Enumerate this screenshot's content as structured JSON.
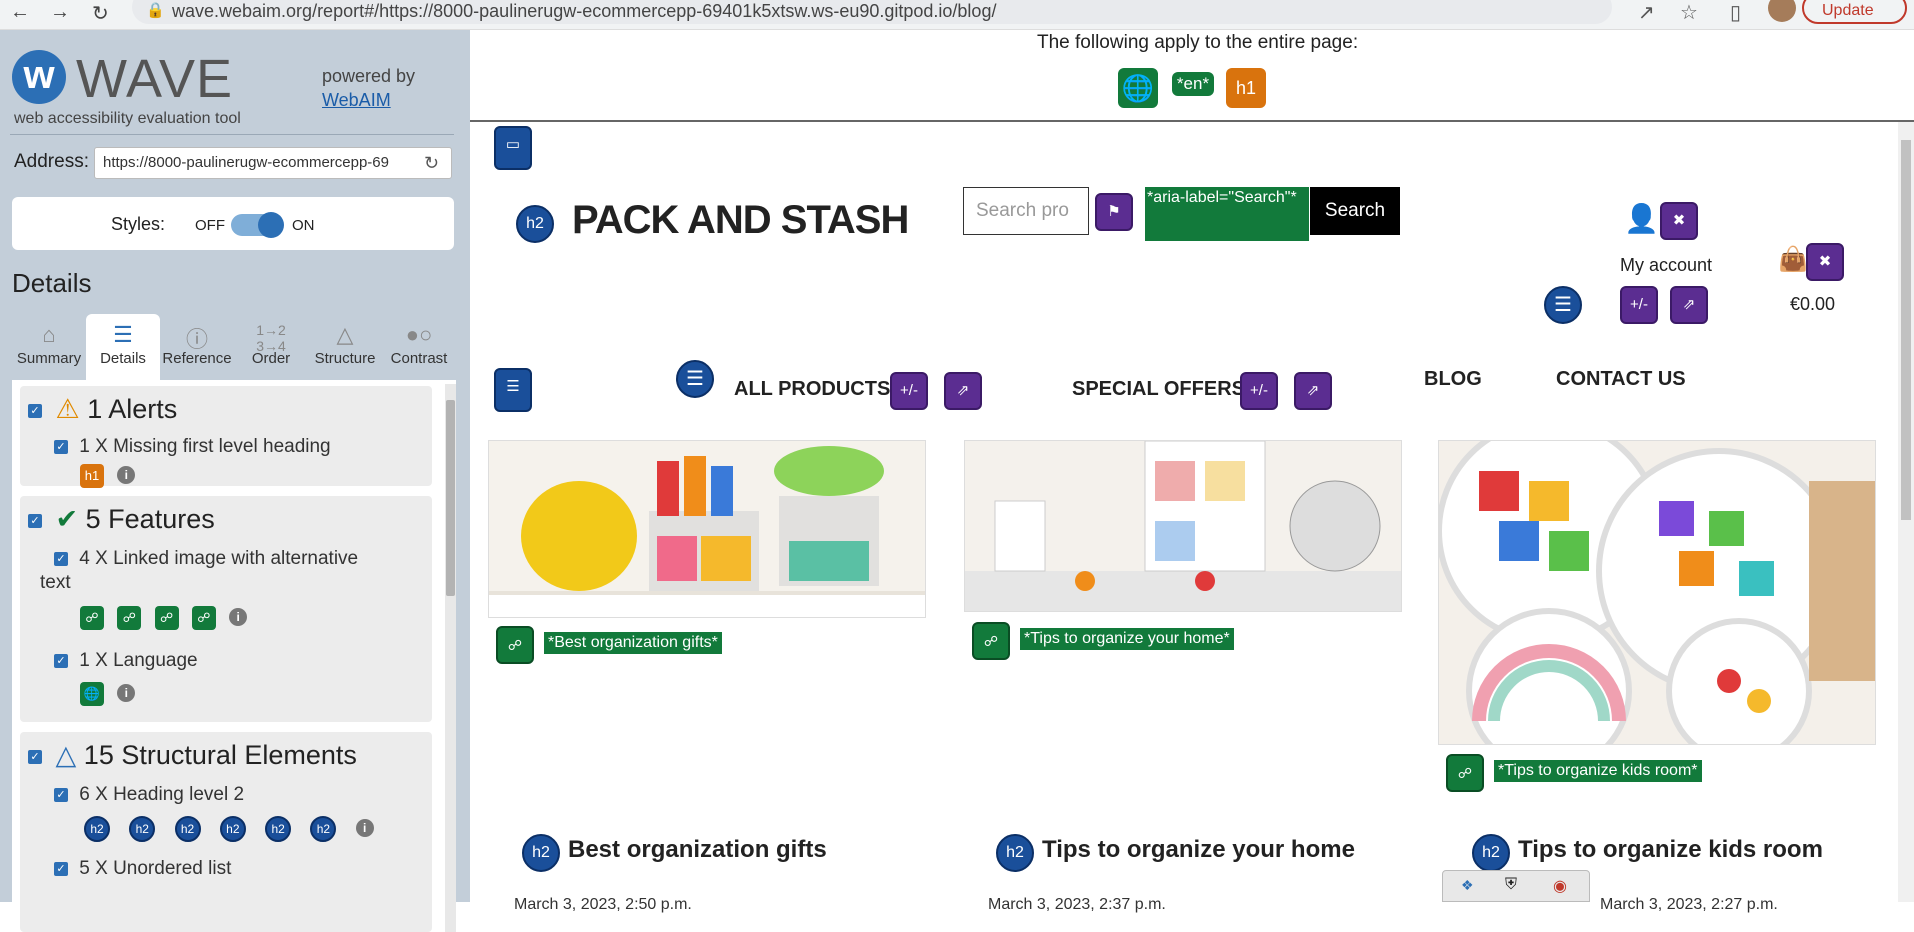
{
  "browser": {
    "url": "wave.webaim.org/report#/https://8000-paulinerugw-ecommercepp-69401k5xtsw.ws-eu90.gitpod.io/blog/",
    "update_label": "Update"
  },
  "sidebar": {
    "logo_mark": "w",
    "logo_word": "WAVE",
    "tagline": "web accessibility evaluation tool",
    "powered_by": "powered by",
    "webaim_link": "WebAIM",
    "address_label": "Address:",
    "address_value": "https://8000-paulinerugw-ecommercepp-69",
    "styles_label": "Styles:",
    "styles_off": "OFF",
    "styles_on": "ON",
    "styles_state": "on",
    "details_heading": "Details",
    "tabs": [
      {
        "label": "Summary",
        "icon": "home-icon"
      },
      {
        "label": "Details",
        "icon": "list-icon"
      },
      {
        "label": "Reference",
        "icon": "info-icon"
      },
      {
        "label": "Order",
        "icon": "order-icon"
      },
      {
        "label": "Structure",
        "icon": "structure-icon"
      },
      {
        "label": "Contrast",
        "icon": "contrast-icon"
      }
    ],
    "active_tab": "Details",
    "categories": {
      "alerts": {
        "title": "1 Alerts",
        "items": [
          {
            "text": "1 X Missing first level heading",
            "badge": "h1"
          }
        ]
      },
      "features": {
        "title": "5 Features",
        "items": [
          {
            "text": "4 X Linked image with alternative",
            "text2": "text"
          },
          {
            "text": "1 X Language"
          }
        ]
      },
      "structure": {
        "title": "15 Structural Elements",
        "items": [
          {
            "text": "6 X Heading level 2",
            "badge": "h2"
          },
          {
            "text": "5 X Unordered list"
          }
        ]
      }
    }
  },
  "page_level": {
    "apply_text": "The following apply to the entire page:",
    "lang_label": "*en*",
    "h1_badge": "h1"
  },
  "site": {
    "heading_badge": "h2",
    "title": "PACK AND STASH",
    "search_placeholder": "Search pro",
    "aria_label": "*aria-label=\"Search\"*",
    "search_button": "Search",
    "my_account": "My account",
    "cart_total": "€0.00",
    "nav": {
      "all_products": "ALL PRODUCTS",
      "special_offers": "SPECIAL OFFERS",
      "blog": "BLOG",
      "contact": "CONTACT US"
    },
    "toggle_badge": "+/-",
    "posts": [
      {
        "alt": "*Best organization gifts*",
        "title": "Best organization gifts",
        "date": "March 3, 2023, 2:50 p.m."
      },
      {
        "alt": "*Tips to organize your home*",
        "title": "Tips to organize your home",
        "date": "March 3, 2023, 2:37 p.m."
      },
      {
        "alt": "*Tips to organize kids room*",
        "title": "Tips to organize kids room",
        "date": "March 3, 2023, 2:27 p.m."
      }
    ]
  },
  "colors": {
    "wave_blue": "#2c6fb5",
    "feature_green": "#127a3b",
    "aria_purple": "#5b2d91",
    "alert_orange": "#d9730d",
    "sidebar_bg": "#c3ced9"
  }
}
